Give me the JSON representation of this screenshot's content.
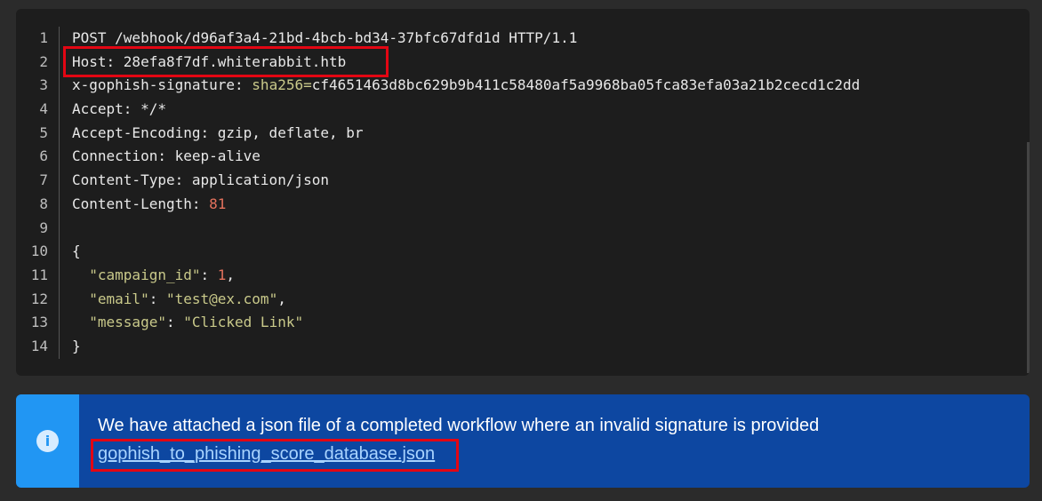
{
  "code": {
    "line_numbers": [
      "1",
      "2",
      "3",
      "4",
      "5",
      "6",
      "7",
      "8",
      "9",
      "10",
      "11",
      "12",
      "13",
      "14"
    ],
    "request_line": "POST /webhook/d96af3a4-21bd-4bcb-bd34-37bfc67dfd1d HTTP/1.1",
    "host": "Host: 28efa8f7df.whiterabbit.htb",
    "sig_key": "x-gophish-signature: ",
    "sig_algo": "sha256=",
    "sig_value": "cf4651463d8bc629b9b411c58480af5a9968ba05fca83efa03a21b2cecd1c2dd",
    "accept": "Accept: */*",
    "accept_encoding": "Accept-Encoding: gzip, deflate, br",
    "connection": "Connection: keep-alive",
    "content_type": "Content-Type: application/json",
    "content_length_key": "Content-Length: ",
    "content_length_value": "81",
    "open_brace": "{",
    "campaign_key": "\"campaign_id\"",
    "campaign_value": "1",
    "email_key": "\"email\"",
    "email_value": "\"test@ex.com\"",
    "message_key": "\"message\"",
    "message_value": "\"Clicked Link\"",
    "close_brace": "}"
  },
  "alert": {
    "icon": "info-icon",
    "text": "We have attached a json file of a completed workflow where an invalid signature is provided",
    "link": "gophish_to_phishing_score_database.json"
  },
  "colors": {
    "highlight": "#e30613",
    "alert_bg": "#0d47a1",
    "alert_side": "#2196f3",
    "code_bg": "#1d1d1d"
  }
}
